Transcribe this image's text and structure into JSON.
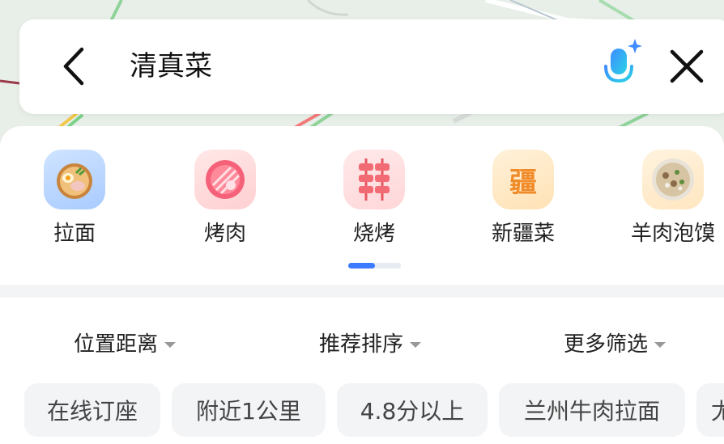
{
  "search": {
    "query": "清真菜"
  },
  "icons": {
    "back": "back-chevron-icon",
    "mic": "ai-voice-mic-icon",
    "close": "close-icon"
  },
  "categories": [
    {
      "label": "拉面",
      "icon": "ramen-bowl-icon"
    },
    {
      "label": "烤肉",
      "icon": "grilled-meat-icon"
    },
    {
      "label": "烧烤",
      "icon": "skewer-icon"
    },
    {
      "label": "新疆菜",
      "icon": "xinjiang-character-icon",
      "glyph": "疆"
    },
    {
      "label": "羊肉泡馍",
      "icon": "lamb-soup-bowl-icon"
    }
  ],
  "pager": {
    "page": 1,
    "pages": 2
  },
  "filters": [
    {
      "label": "位置距离"
    },
    {
      "label": "推荐排序"
    },
    {
      "label": "更多筛选"
    }
  ],
  "chips": [
    {
      "label": "在线订座"
    },
    {
      "label": "附近1公里"
    },
    {
      "label": "4.8分以上"
    },
    {
      "label": "兰州牛肉拉面"
    },
    {
      "label": "尤"
    }
  ],
  "colors": {
    "accent": "#3c7bff",
    "chip_bg": "#f3f4f6",
    "text": "#222222"
  }
}
